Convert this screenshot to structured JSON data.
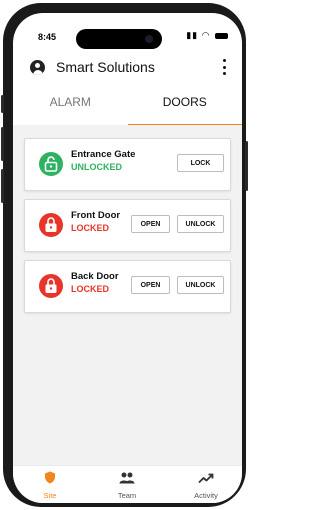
{
  "status_bar": {
    "time": "8:45"
  },
  "app_bar": {
    "title": "Smart Solutions"
  },
  "tabs": [
    {
      "label": "ALARM"
    },
    {
      "label": "DOORS"
    }
  ],
  "doors": [
    {
      "name": "Entrance Gate",
      "status": "UNLOCKED",
      "status_color": "#2fb162",
      "actions": [
        "LOCK"
      ]
    },
    {
      "name": "Front Door",
      "status": "LOCKED",
      "status_color": "#e8352c",
      "actions": [
        "OPEN",
        "UNLOCK"
      ]
    },
    {
      "name": "Back Door",
      "status": "LOCKED",
      "status_color": "#e8352c",
      "actions": [
        "OPEN",
        "UNLOCK"
      ]
    }
  ],
  "bottom_nav": [
    {
      "label": "Site",
      "icon": "shield-icon"
    },
    {
      "label": "Team",
      "icon": "team-icon"
    },
    {
      "label": "Activity",
      "icon": "trend-icon"
    }
  ],
  "colors": {
    "accent": "#f0861d",
    "unlocked": "#2fb162",
    "locked": "#e8352c"
  }
}
